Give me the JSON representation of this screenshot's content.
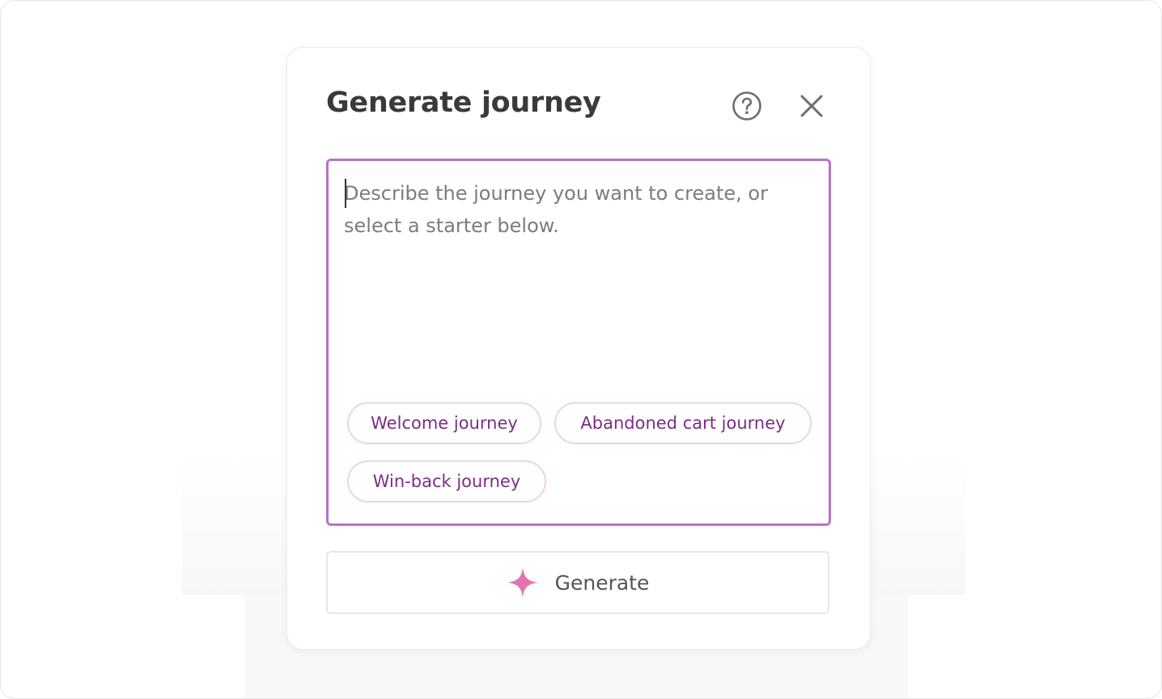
{
  "dialog": {
    "title": "Generate journey",
    "help_icon": "help-circle-icon",
    "close_icon": "close-icon"
  },
  "prompt": {
    "value": "",
    "placeholder": "Describe the journey you want to create, or select a starter below."
  },
  "starters": [
    {
      "label": "Welcome journey"
    },
    {
      "label": "Abandoned cart journey"
    },
    {
      "label": "Win-back journey"
    }
  ],
  "generate": {
    "label": "Generate",
    "icon": "sparkle-icon"
  },
  "colors": {
    "accent_border": "#b574c6",
    "chip_text": "#7b2d86",
    "chip_border": "#ecd3ee",
    "sparkle": "#e86aa8"
  }
}
